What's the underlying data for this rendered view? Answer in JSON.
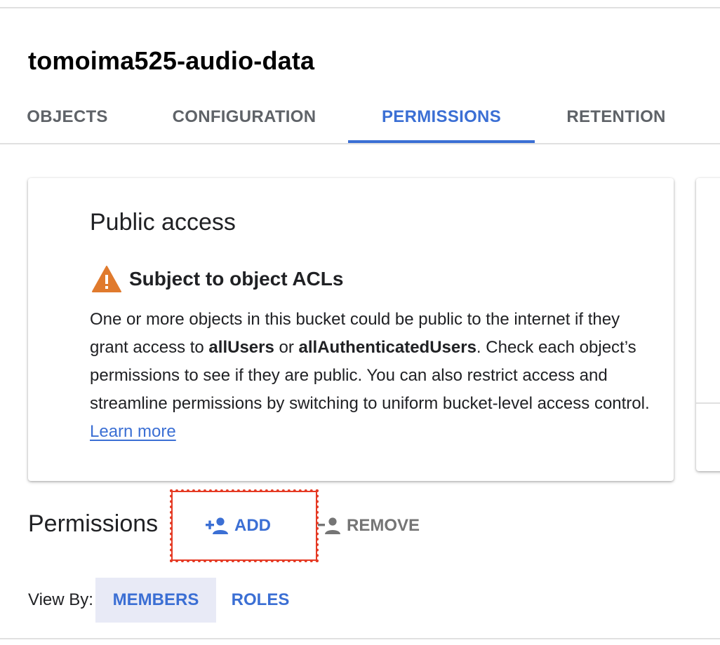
{
  "bucket": {
    "title": "tomoima525-audio-data"
  },
  "tabs": [
    {
      "label": "OBJECTS",
      "active": false
    },
    {
      "label": "CONFIGURATION",
      "active": false
    },
    {
      "label": "PERMISSIONS",
      "active": true
    },
    {
      "label": "RETENTION",
      "active": false
    }
  ],
  "public_access": {
    "heading": "Public access",
    "warning_icon": "warning-triangle-icon",
    "warning_title": "Subject to object ACLs",
    "body_part1": "One or more objects in this bucket could be public to the internet if they grant access to ",
    "bold1": "allUsers",
    "body_part2": " or ",
    "bold2": "allAuthenticatedUsers",
    "body_part3": ". Check each object’s permissions to see if they are public. You can also restrict access and streamline permissions by switching to uniform bucket-level access control. ",
    "link": "Learn more"
  },
  "permissions": {
    "heading": "Permissions",
    "add_label": "ADD",
    "add_icon": "person-add-icon",
    "remove_label": "REMOVE",
    "remove_icon": "person-remove-icon"
  },
  "view_by": {
    "label": "View By:",
    "options": [
      {
        "label": "MEMBERS",
        "selected": true
      },
      {
        "label": "ROLES",
        "selected": false
      }
    ]
  },
  "colors": {
    "accent": "#3b6fd4",
    "warning": "#e07a2d",
    "highlight": "#e53a24"
  }
}
